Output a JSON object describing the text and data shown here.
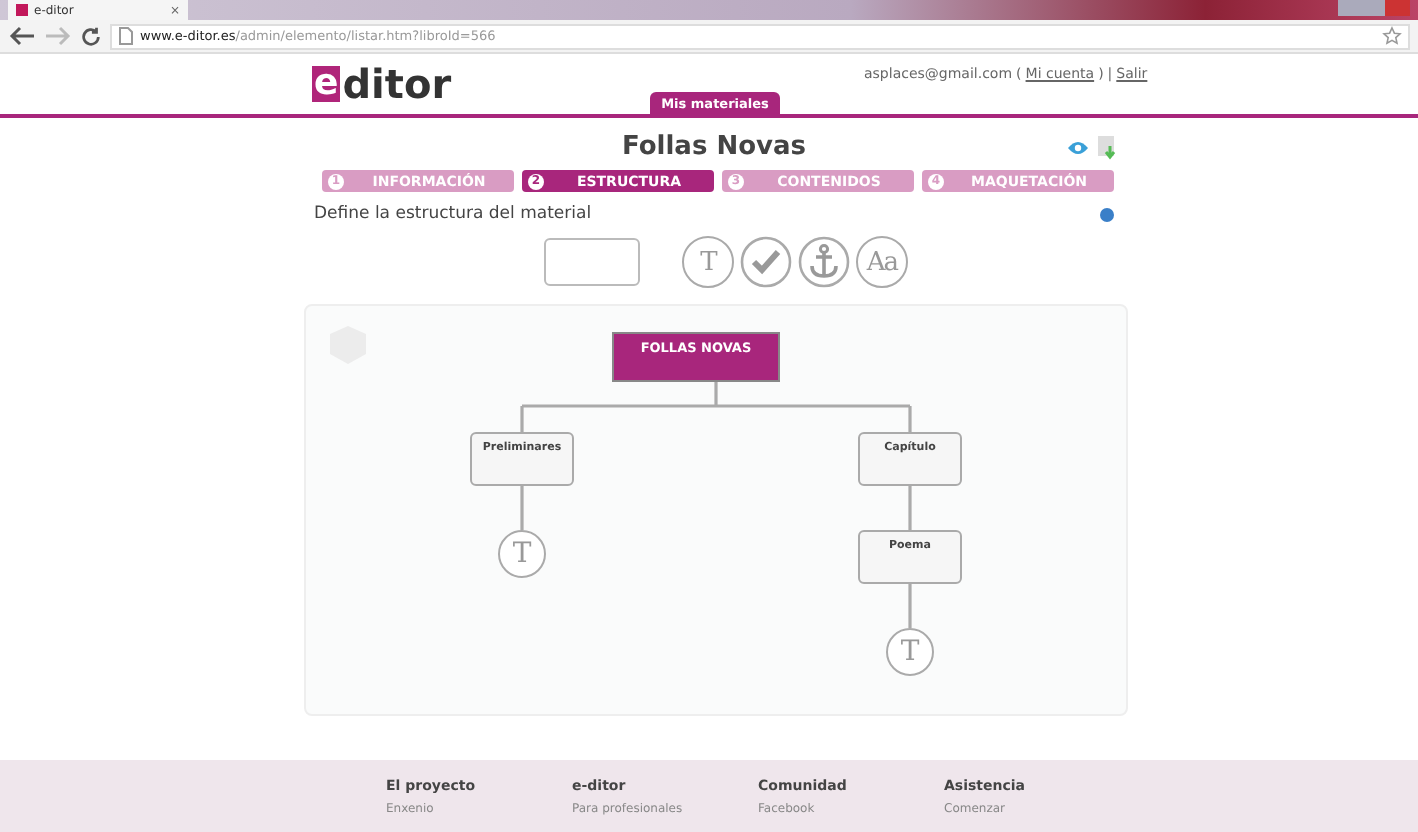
{
  "browser": {
    "tab_title": "e-ditor",
    "tab_close": "×",
    "url_host": "www.e-ditor.es",
    "url_path": "/admin/elemento/listar.htm?libroId=566"
  },
  "header": {
    "logo_mark": "e",
    "logo_rest": "ditor",
    "user_email": "asplaces@gmail.com",
    "account_open": "(",
    "account_link": "Mi cuenta",
    "account_close": ")",
    "separator": "|",
    "logout_link": "Salir",
    "nav_tab": "Mis materiales"
  },
  "material_title": "Follas Novas",
  "steps": [
    {
      "number": "1",
      "label": "INFORMACIÓN",
      "selected": false
    },
    {
      "number": "2",
      "label": "ESTRUCTURA",
      "selected": true
    },
    {
      "number": "3",
      "label": "CONTENIDOS",
      "selected": false
    },
    {
      "number": "4",
      "label": "MAQUETACIÓN",
      "selected": false
    }
  ],
  "instruction": "Define la estructura del material",
  "tools": [
    {
      "kind": "box"
    },
    {
      "kind": "glyph",
      "glyph": "T"
    },
    {
      "kind": "check"
    },
    {
      "kind": "anchor"
    },
    {
      "kind": "glyph",
      "glyph": "Aa"
    }
  ],
  "tree": {
    "title": "FOLLAS NOVAS",
    "children": [
      {
        "kind": "section",
        "title": "Preliminares",
        "children": [
          {
            "kind": "glyph",
            "glyph": "T"
          }
        ]
      },
      {
        "kind": "section",
        "title": "Capítulo",
        "children": [
          {
            "kind": "section",
            "title": "Poema",
            "children": [
              {
                "kind": "glyph",
                "glyph": "T"
              }
            ]
          }
        ]
      }
    ]
  },
  "footer": [
    {
      "heading": "El proyecto",
      "links": [
        "Enxenio"
      ]
    },
    {
      "heading": "e-ditor",
      "links": [
        "Para profesionales"
      ]
    },
    {
      "heading": "Comunidad",
      "links": [
        "Facebook"
      ]
    },
    {
      "heading": "Asistencia",
      "links": [
        "Comenzar"
      ]
    }
  ]
}
